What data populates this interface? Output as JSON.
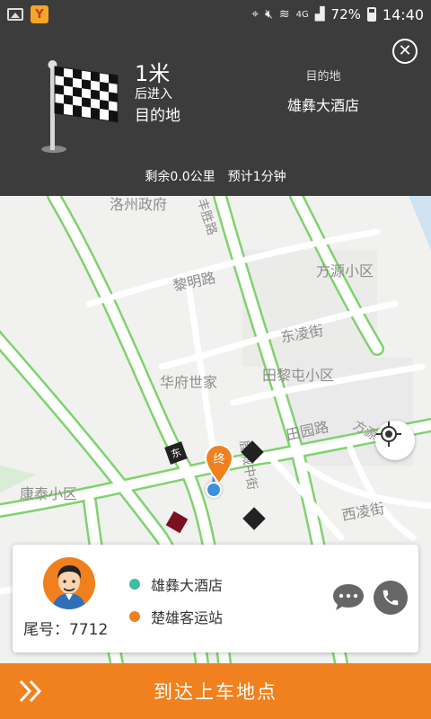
{
  "status_bar": {
    "app_badge": "Y",
    "network": "4G",
    "battery": "72%",
    "time": "14:40"
  },
  "nav": {
    "distance": "1米",
    "action_line1": "后进入",
    "action_line2": "目的地",
    "dest_caption": "目的地",
    "dest_name": "雄彝大酒店",
    "remaining": "剩余0.0公里",
    "eta": "预计1分钟"
  },
  "map": {
    "labels": {
      "l1": "洛州政府",
      "l2": "黎明路",
      "l3": "方源小区",
      "l4": "东凌街",
      "l5": "华府世家",
      "l6": "田黎屯小区",
      "l7": "田园路",
      "l8": "康泰小区",
      "l9": "西凌街",
      "l10": "方源街"
    },
    "road_vertical": "丰胜路",
    "road_center": "鹿城中街",
    "end_marker": "终",
    "colors": {
      "road_border": "#7fd36d",
      "end_marker": "#f0811e",
      "current_location": "#3d8fe0"
    }
  },
  "card": {
    "tail_number": "尾号：7712",
    "pickup": "雄彝大酒店",
    "dropoff": "楚雄客运站",
    "pickup_dot_color": "#3cbf9c",
    "dropoff_dot_color": "#f0811e"
  },
  "action_bar": {
    "label": "到达上车地点",
    "color": "#f0811e"
  },
  "icons": {
    "close": "close-icon",
    "locate": "locate-icon",
    "chat": "chat-icon",
    "phone": "phone-icon",
    "flag": "checkered-flag-icon",
    "arrows": "double-chevron-icon"
  }
}
